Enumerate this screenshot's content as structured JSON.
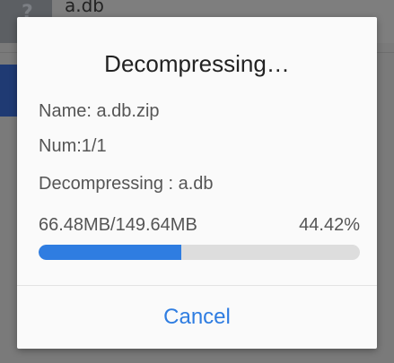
{
  "background": {
    "file_icon_glyph": "?",
    "file_name": "a.db"
  },
  "dialog": {
    "title": "Decompressing…",
    "name_line": "Name: a.db.zip",
    "num_line": "Num:1/1",
    "status_line": "Decompressing : a.db",
    "progress_size": "66.48MB/149.64MB",
    "progress_percent": "44.42%",
    "progress_fraction": 0.4442,
    "cancel_label": "Cancel"
  },
  "colors": {
    "accent": "#2f7de1",
    "track": "#dddddd",
    "dialog_bg": "#fafafa"
  }
}
